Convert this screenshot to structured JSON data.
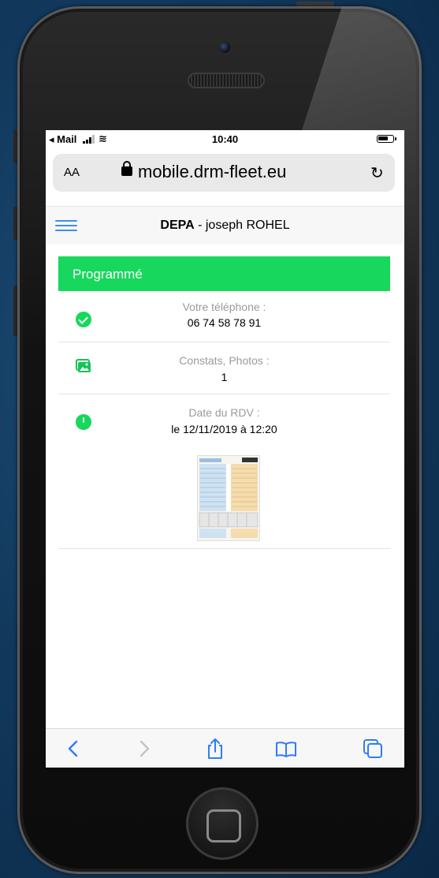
{
  "status_bar": {
    "back_app": "◂ Mail",
    "time": "10:40"
  },
  "url_bar": {
    "aa_label": "AA",
    "url": "mobile.drm-fleet.eu"
  },
  "header": {
    "company": "DEPA",
    "separator": " - ",
    "user": "joseph ROHEL"
  },
  "status_banner": {
    "label": "Programmé",
    "color": "#17d85c"
  },
  "details": [
    {
      "icon": "check-circle-icon",
      "label": "Votre téléphone :",
      "value": "06 74 58 78 91"
    },
    {
      "icon": "photos-icon",
      "label": "Constats, Photos :",
      "value": "1"
    },
    {
      "icon": "clock-icon",
      "label": "Date du RDV :",
      "value": "le 12/11/2019 à 12:20"
    }
  ],
  "toolbar": {
    "accent": "#2f7cf6",
    "icons": [
      "back-arrow-icon",
      "forward-arrow-icon",
      "share-icon",
      "bookmarks-icon",
      "tabs-icon"
    ]
  }
}
